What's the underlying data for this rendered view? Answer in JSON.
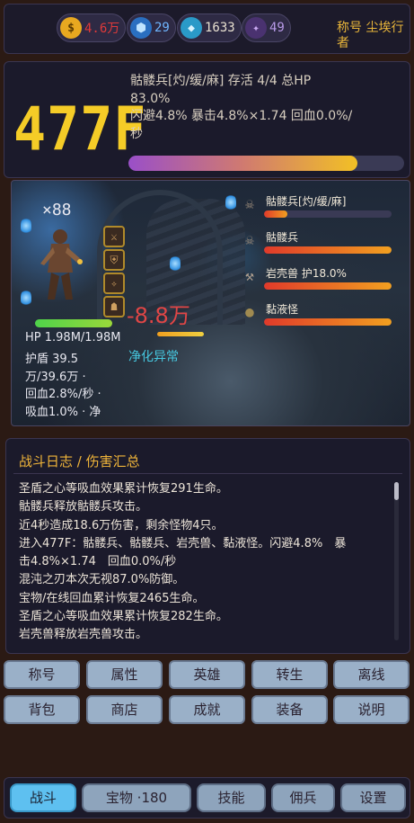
{
  "currencies": [
    {
      "icon": "gold-coin-icon",
      "value": "4.6万",
      "color": "#e03a3a"
    },
    {
      "icon": "blue-gem-icon",
      "value": "29",
      "color": "#6fb6ff"
    },
    {
      "icon": "diamond-icon",
      "value": "1633",
      "color": "#e8e8f0"
    },
    {
      "icon": "purple-crystal-icon",
      "value": "49",
      "color": "#b89ae8"
    }
  ],
  "title_label": "称号 尘埃行者",
  "floor": "477F",
  "stats": {
    "line1": "骷髅兵[灼/缓/麻]  存活 4/4  总HP",
    "line2": "83.0%",
    "line3": "闪避4.8%  暴击4.8%×1.74  回血0.0%/",
    "line4": "秒"
  },
  "enemies_hp_fraction": 0.83,
  "scene": {
    "hero_count": "×88",
    "damage": "-8.8万",
    "status_effect": "净化异常",
    "hero_hp": "HP 1.98M/1.98M",
    "hero_stats": [
      "护盾 39.5",
      "万/39.6万  ·",
      "回血2.8%/秒  ·",
      "吸血1.0%  · 净"
    ],
    "enemies": [
      {
        "name": "骷髅兵[灼/缓/麻]",
        "icon": "skeleton-icon",
        "hp": 0.18
      },
      {
        "name": "骷髅兵",
        "icon": "skeleton-icon",
        "hp": 1.0
      },
      {
        "name": "岩壳兽 护18.0%",
        "icon": "axe-icon",
        "hp": 1.0
      },
      {
        "name": "黏液怪",
        "icon": "slime-icon",
        "hp": 1.0
      }
    ]
  },
  "log": {
    "title": "战斗日志 / 伤害汇总",
    "lines": [
      "圣盾之心等吸血效果累计恢复291生命。",
      "骷髅兵释放骷髅兵攻击。",
      "近4秒造成18.6万伤害，剩余怪物4只。",
      "进入477F：骷髅兵、骷髅兵、岩壳兽、黏液怪。闪避4.8%　暴",
      "击4.8%×1.74　回血0.0%/秒",
      "混沌之刃本次无视87.0%防御。",
      "宝物/在线回血累计恢复2465生命。",
      "圣盾之心等吸血效果累计恢复282生命。",
      "岩壳兽释放岩壳兽攻击。"
    ]
  },
  "menu": {
    "row1": [
      "称号",
      "属性",
      "英雄",
      "转生",
      "离线"
    ],
    "row2": [
      "背包",
      "商店",
      "成就",
      "装备",
      "说明"
    ]
  },
  "nav": [
    {
      "label": "战斗",
      "active": true
    },
    {
      "label": "宝物 ·180",
      "active": false
    },
    {
      "label": "技能",
      "active": false
    },
    {
      "label": "佣兵",
      "active": false
    },
    {
      "label": "设置",
      "active": false
    }
  ]
}
